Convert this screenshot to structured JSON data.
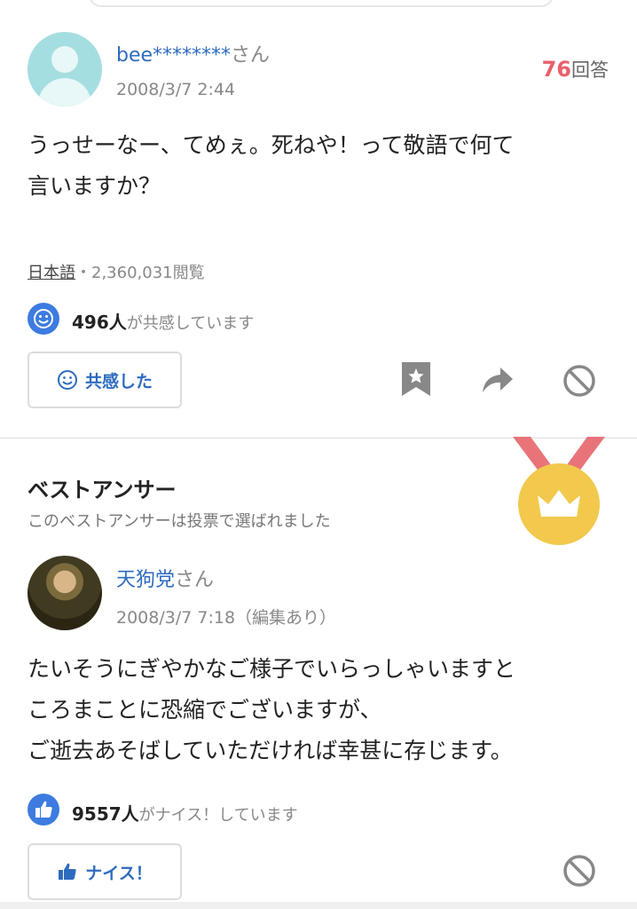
{
  "question": {
    "user_name": "bee********",
    "honorific": "さん",
    "date": "2008/3/7 2:44",
    "answer_count": "76",
    "answer_label": "回答",
    "text_line1": "うっせーなー、てめぇ。死ねや！って敬語で何て",
    "text_line2": "言いますか？",
    "category": "日本語",
    "views": "・2,360,031閲覧",
    "empathy_count": "496人",
    "empathy_suffix": "が共感しています",
    "empathy_button": "共感した"
  },
  "best_answer": {
    "title": "ベストアンサー",
    "subtitle": "このベストアンサーは投票で選ばれました",
    "user_name": "天狗党",
    "honorific": "さん",
    "date": "2008/3/7 7:18（編集あり）",
    "text_line1": "たいそうにぎやかなご様子でいらっしゃいますと",
    "text_line2": "ころまことに恐縮でございますが、",
    "text_line3": "ご逝去あそばしていただければ幸甚に存じます。",
    "nice_count": "9557人",
    "nice_suffix": "がナイス！しています",
    "nice_button": "ナイス！"
  },
  "colors": {
    "link_blue": "#2e6bbf",
    "accent_red": "#e85f6a",
    "icon_blue": "#3d7be0",
    "medal_gold": "#f2c94c",
    "ribbon_red": "#e8747a"
  },
  "icons": [
    "user-avatar-icon",
    "smile-icon",
    "bookmark-icon",
    "share-icon",
    "block-icon",
    "medal-icon",
    "crown-icon",
    "thumbs-up-icon"
  ]
}
